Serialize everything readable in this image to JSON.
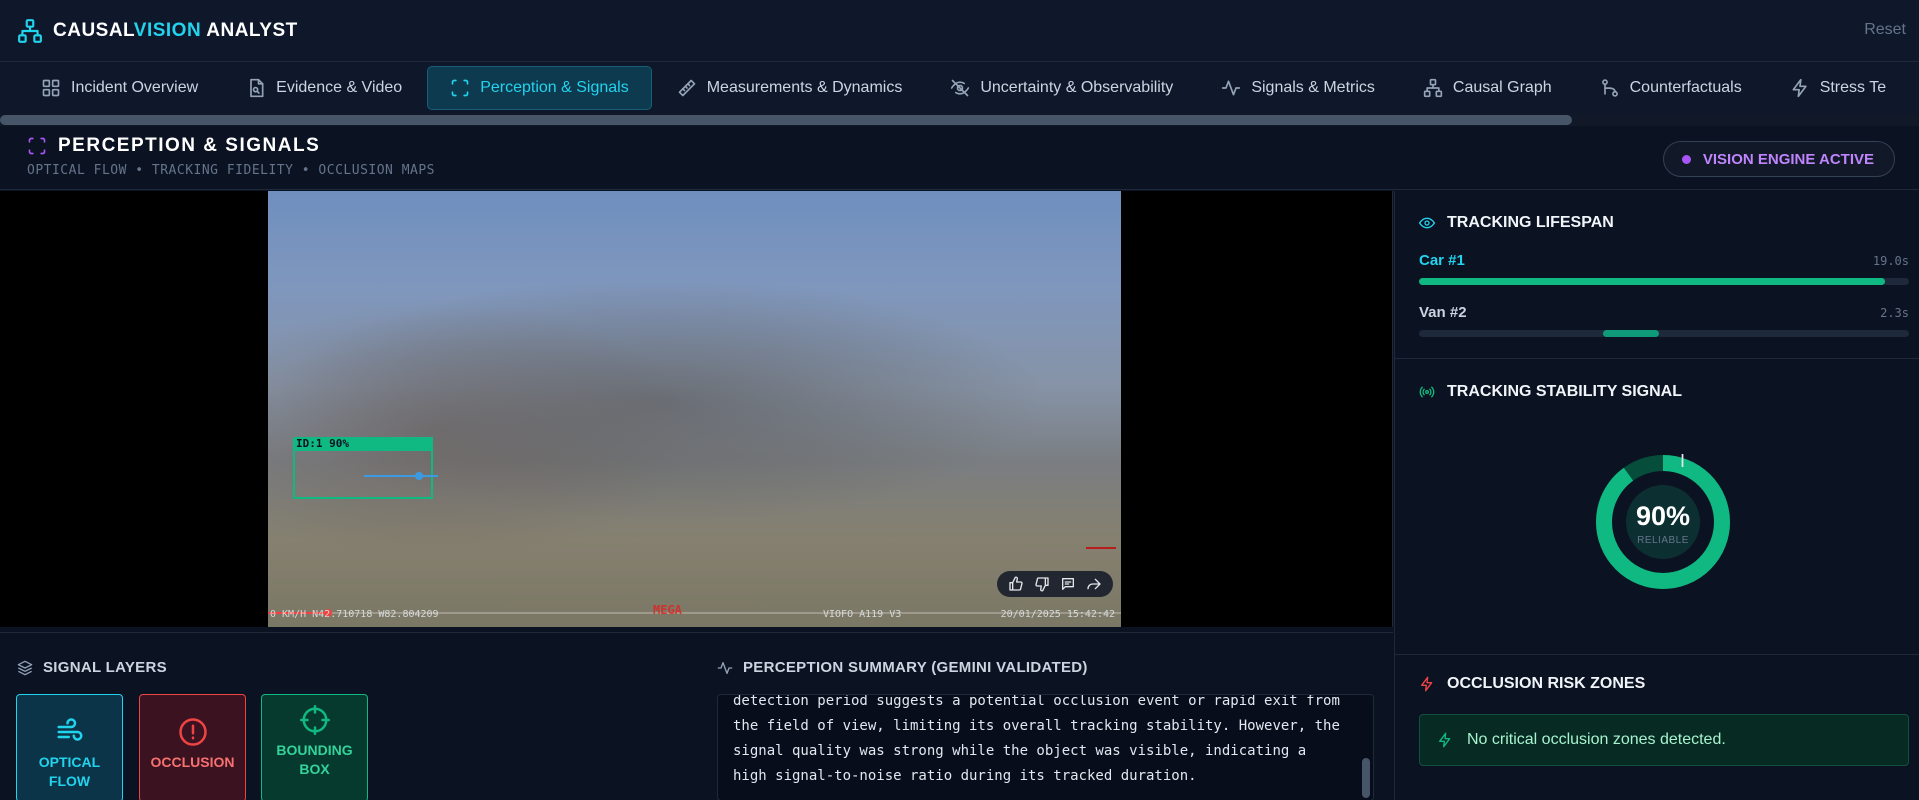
{
  "app": {
    "brand_part1": "CAUSAL",
    "brand_part2": "VISION",
    "brand_part3": " ANALYST",
    "reset_label": "Reset",
    "brand_icon": "network-icon"
  },
  "tabs": [
    {
      "label": "Incident Overview",
      "icon": "grid-icon"
    },
    {
      "label": "Evidence & Video",
      "icon": "file-search-icon"
    },
    {
      "label": "Perception & Signals",
      "icon": "scan-icon",
      "active": true
    },
    {
      "label": "Measurements & Dynamics",
      "icon": "ruler-icon"
    },
    {
      "label": "Uncertainty & Observability",
      "icon": "eye-off-icon"
    },
    {
      "label": "Signals & Metrics",
      "icon": "activity-icon"
    },
    {
      "label": "Causal Graph",
      "icon": "network-icon"
    },
    {
      "label": "Counterfactuals",
      "icon": "branch-icon"
    },
    {
      "label": "Stress Te",
      "icon": "zap-icon"
    }
  ],
  "section": {
    "title": "PERCEPTION & SIGNALS",
    "subtitle": "OPTICAL FLOW • TRACKING FIDELITY • OCCLUSION MAPS",
    "engine_status": "VISION ENGINE ACTIVE"
  },
  "video": {
    "bbox_label": "ID:1 90%",
    "osd_left": "0 KM/H N42.710718 W82.804209",
    "osd_brand": "MEGA",
    "osd_model": "VIOFO A119 V3",
    "osd_time": "20/01/2025 15:42:42",
    "playback_progress": 0.07,
    "actions": [
      "thumbs-up-icon",
      "thumbs-down-icon",
      "comment-icon",
      "share-icon"
    ]
  },
  "signal_layers": {
    "title": "SIGNAL LAYERS",
    "items": [
      {
        "label": "OPTICAL FLOW",
        "icon": "wind-icon",
        "color": "#22d3ee"
      },
      {
        "label": "OCCLUSION",
        "icon": "alert-circle-icon",
        "color": "#ef4444"
      },
      {
        "label": "BOUNDING BOX",
        "icon": "crosshair-icon",
        "color": "#10b981"
      }
    ]
  },
  "summary": {
    "title": "PERCEPTION SUMMARY (GEMINI VALIDATED)",
    "text": "detection period suggests a potential occlusion event or rapid exit from the field of view, limiting its overall tracking stability. However, the signal quality was strong while the object was visible, indicating a high signal-to-noise ratio during its tracked duration."
  },
  "tracking_lifespan": {
    "title": "TRACKING LIFESPAN",
    "tracks": [
      {
        "name": "Car #1",
        "duration": "19.0s",
        "start": 0.0,
        "end": 0.95,
        "color": "#10b981",
        "name_color": "#22d3ee"
      },
      {
        "name": "Van #2",
        "duration": "2.3s",
        "start": 0.375,
        "end": 0.49,
        "color": "#0f9b7a",
        "name_color": "#cbd5e1"
      }
    ]
  },
  "stability": {
    "title": "TRACKING STABILITY SIGNAL",
    "value_text": "90%",
    "value": 0.9,
    "label": "RELIABLE"
  },
  "occlusion_zones": {
    "title": "OCCLUSION RISK ZONES",
    "message": "No critical occlusion zones detected."
  },
  "colors": {
    "accent": "#22d3ee",
    "success": "#10b981",
    "danger": "#ef4444",
    "engine": "#a855f7"
  }
}
